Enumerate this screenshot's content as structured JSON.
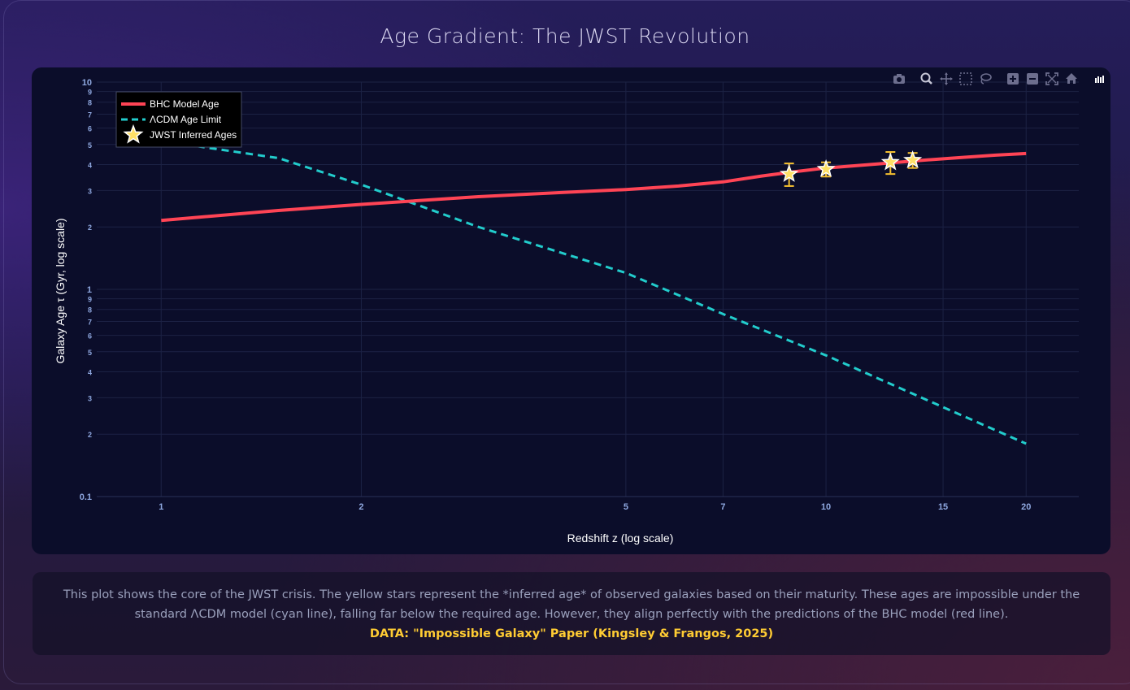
{
  "title": "Age Gradient: The JWST Revolution",
  "toolbar": {
    "icons": [
      "camera-icon",
      "zoom-icon",
      "pan-icon",
      "box-select-icon",
      "lasso-icon",
      "zoom-in-icon",
      "zoom-out-icon",
      "autoscale-icon",
      "reset-axes-icon",
      "plotly-logo-icon"
    ]
  },
  "colors": {
    "bhc": "#ff4455",
    "lcdm": "#22cccc",
    "jwst": "#ffe066",
    "grid": "#1c2244",
    "tick": "#8fa8e0"
  },
  "chart_data": {
    "type": "line",
    "title": "",
    "xlabel": "Redshift z (log scale)",
    "ylabel": "Galaxy Age τ (Gyr, log scale)",
    "x_scale": "log",
    "y_scale": "log",
    "xlim": [
      0.8,
      24
    ],
    "ylim": [
      0.1,
      10
    ],
    "grid": true,
    "legend_position": "top-left",
    "x_ticks": [
      1,
      2,
      5,
      7,
      10,
      15,
      20
    ],
    "x_tick_labels": [
      "1",
      "2",
      "5",
      "7",
      "10",
      "15",
      "20"
    ],
    "y_ticks": [
      {
        "v": 0.1,
        "label": "0.1",
        "major": true
      },
      {
        "v": 0.2,
        "label": "2",
        "major": false
      },
      {
        "v": 0.3,
        "label": "3",
        "major": false
      },
      {
        "v": 0.4,
        "label": "4",
        "major": false
      },
      {
        "v": 0.5,
        "label": "5",
        "major": false
      },
      {
        "v": 0.6,
        "label": "6",
        "major": false
      },
      {
        "v": 0.7,
        "label": "7",
        "major": false
      },
      {
        "v": 0.8,
        "label": "8",
        "major": false
      },
      {
        "v": 0.9,
        "label": "9",
        "major": false
      },
      {
        "v": 1,
        "label": "1",
        "major": true
      },
      {
        "v": 2,
        "label": "2",
        "major": false
      },
      {
        "v": 3,
        "label": "3",
        "major": false
      },
      {
        "v": 4,
        "label": "4",
        "major": false
      },
      {
        "v": 5,
        "label": "5",
        "major": false
      },
      {
        "v": 6,
        "label": "6",
        "major": false
      },
      {
        "v": 7,
        "label": "7",
        "major": false
      },
      {
        "v": 8,
        "label": "8",
        "major": false
      },
      {
        "v": 9,
        "label": "9",
        "major": false
      },
      {
        "v": 10,
        "label": "10",
        "major": true
      }
    ],
    "series": [
      {
        "name": "BHC Model Age",
        "style": "solid",
        "x": [
          1,
          1.5,
          2,
          3,
          4,
          5,
          6,
          7,
          8,
          9,
          10,
          12,
          14,
          16,
          18,
          20
        ],
        "y": [
          2.15,
          2.4,
          2.57,
          2.8,
          2.93,
          3.03,
          3.15,
          3.3,
          3.52,
          3.7,
          3.85,
          4.03,
          4.2,
          4.33,
          4.44,
          4.52
        ]
      },
      {
        "name": "ΛCDM Age Limit",
        "style": "dash",
        "x": [
          1,
          1.5,
          2,
          3,
          5,
          7,
          10,
          15,
          20
        ],
        "y": [
          5.2,
          4.3,
          3.2,
          2.0,
          1.2,
          0.76,
          0.48,
          0.27,
          0.18
        ]
      },
      {
        "name": "JWST Inferred Ages",
        "style": "markers",
        "x": [
          8.8,
          10,
          12.5,
          13.5
        ],
        "y": [
          3.6,
          3.8,
          4.1,
          4.2
        ],
        "err": [
          0.45,
          0.3,
          0.5,
          0.35
        ]
      }
    ]
  },
  "caption": {
    "text": "This plot shows the core of the JWST crisis. The yellow stars represent the *inferred age* of observed galaxies based on their maturity. These ages are impossible under the standard ΛCDM model (cyan line), falling far below the required age. However, they align perfectly with the predictions of the BHC model (red line).",
    "source": "DATA: \"Impossible Galaxy\" Paper (Kingsley & Frangos, 2025)"
  }
}
